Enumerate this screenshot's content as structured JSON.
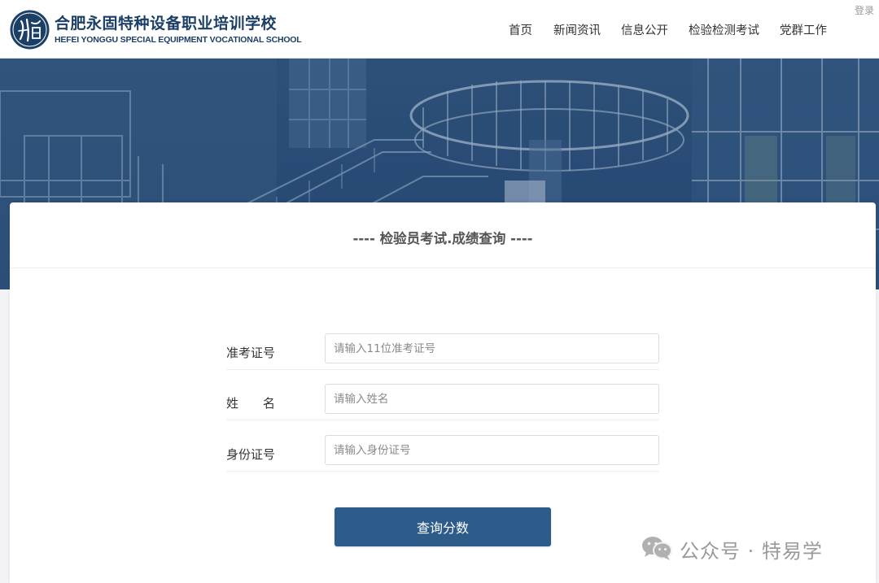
{
  "header": {
    "school_name_cn": "合肥永固特种设备职业培训学校",
    "school_name_en": "HEFEI YONGGU SPECIAL EQUIPMENT VOCATIONAL SCHOOL",
    "logo_icon": "school-emblem-icon",
    "nav": [
      {
        "label": "首页"
      },
      {
        "label": "新闻资讯"
      },
      {
        "label": "信息公开"
      },
      {
        "label": "检验检测考试"
      },
      {
        "label": "党群工作"
      }
    ],
    "login_label": "登录"
  },
  "card": {
    "title": "----  检验员考试.成绩查询  ----"
  },
  "form": {
    "fields": [
      {
        "label": "准考证号",
        "placeholder": "请输入11位准考证号",
        "value": ""
      },
      {
        "label": "姓　　名",
        "placeholder": "请输入姓名",
        "value": ""
      },
      {
        "label": "身份证号",
        "placeholder": "请输入身份证号",
        "value": ""
      }
    ],
    "submit_label": "查询分数"
  },
  "watermark": {
    "icon": "wechat-icon",
    "text": "公众号 · 特易学"
  },
  "colors": {
    "brand": "#1c3f66",
    "button": "#2e5c8a",
    "banner": "#2b4e78"
  }
}
